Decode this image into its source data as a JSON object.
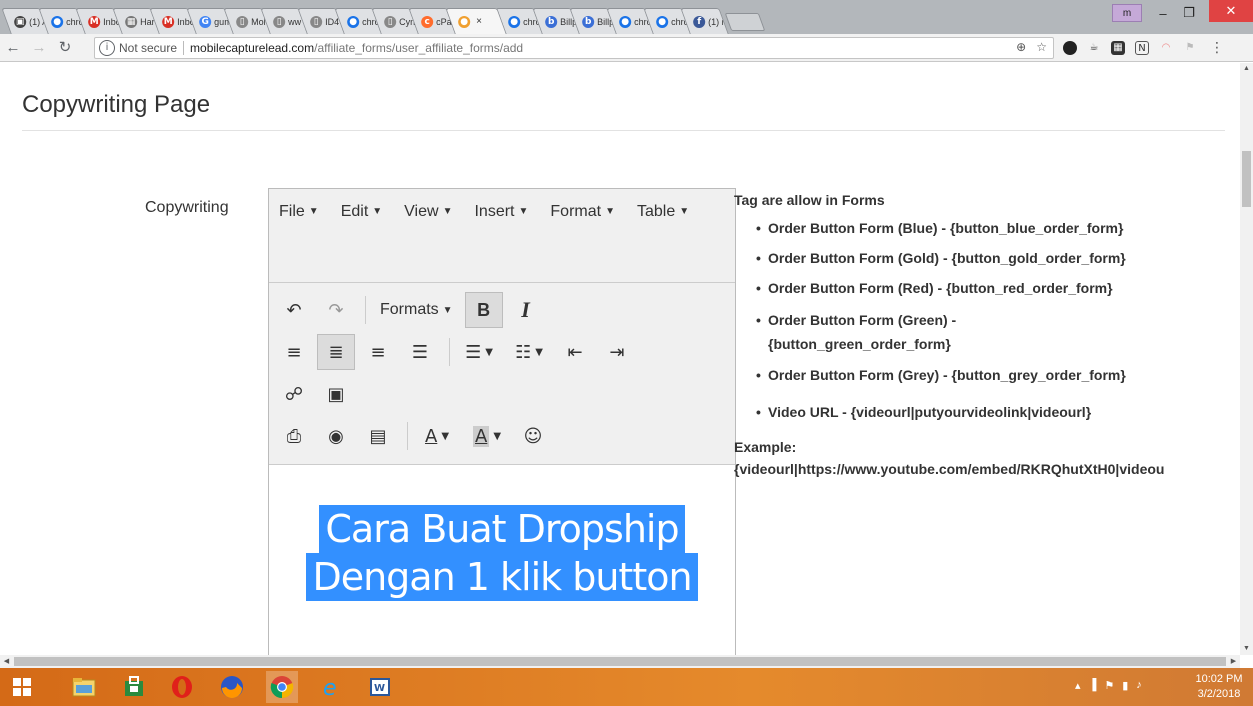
{
  "browser": {
    "tabs": [
      {
        "title": "(1) A",
        "icon": "app-icon",
        "color": "#444444",
        "glyph": "▣"
      },
      {
        "title": "chro",
        "icon": "chrome-icon",
        "color": "#1a73e8",
        "glyph": "●"
      },
      {
        "title": "Inbo",
        "icon": "gmail-icon",
        "color": "#d93025",
        "glyph": "M"
      },
      {
        "title": "Har",
        "icon": "image-icon",
        "color": "#777777",
        "glyph": "▦"
      },
      {
        "title": "Inbo",
        "icon": "gmail-icon",
        "color": "#d93025",
        "glyph": "M"
      },
      {
        "title": "gum",
        "icon": "google-icon",
        "color": "#4285f4",
        "glyph": "G"
      },
      {
        "title": "Mol",
        "icon": "page-icon",
        "color": "#888888",
        "glyph": "▯"
      },
      {
        "title": "ww",
        "icon": "page-icon",
        "color": "#888888",
        "glyph": "▯"
      },
      {
        "title": "ID4",
        "icon": "page-icon",
        "color": "#888888",
        "glyph": "▯"
      },
      {
        "title": "chro",
        "icon": "chrome-icon",
        "color": "#1a73e8",
        "glyph": "●"
      },
      {
        "title": "Cyn",
        "icon": "page-icon",
        "color": "#888888",
        "glyph": "▯"
      },
      {
        "title": "cPa",
        "icon": "cpanel-icon",
        "color": "#ff6c2c",
        "glyph": "c"
      },
      {
        "title": "",
        "icon": "active-site-icon",
        "color": "#f0a030",
        "glyph": "●",
        "active": true
      },
      {
        "title": "chro",
        "icon": "chrome-icon",
        "color": "#1a73e8",
        "glyph": "●"
      },
      {
        "title": "Billp",
        "icon": "billplz-icon",
        "color": "#3b6fd6",
        "glyph": "b"
      },
      {
        "title": "Billp",
        "icon": "billplz-icon",
        "color": "#3b6fd6",
        "glyph": "b"
      },
      {
        "title": "chro",
        "icon": "chrome-icon",
        "color": "#1a73e8",
        "glyph": "●"
      },
      {
        "title": "chro",
        "icon": "chrome-icon",
        "color": "#1a73e8",
        "glyph": "●"
      },
      {
        "title": "(1) r",
        "icon": "facebook-icon",
        "color": "#3b5998",
        "glyph": "f"
      }
    ],
    "address": {
      "security": "Not secure",
      "host": "mobilecapturelead.com",
      "path": "/affiliate_forms/user_affiliate_forms/add"
    }
  },
  "page": {
    "title": "Copywriting Page",
    "field_label": "Copywriting"
  },
  "editor": {
    "menus": [
      "File",
      "Edit",
      "View",
      "Insert",
      "Format",
      "Table"
    ],
    "formats_label": "Formats",
    "bold": "B",
    "italic": "I",
    "font_color_letter": "A",
    "bg_color_letter": "A",
    "content_lines": [
      "Cara Buat Dropship",
      "Dengan 1 klik button"
    ]
  },
  "tags": {
    "heading": "Tag are allow in Forms",
    "items": [
      "Order Button Form (Blue) - {button_blue_order_form}",
      "Order Button Form (Gold) - {button_gold_order_form}",
      "Order Button Form (Red) - {button_red_order_form}",
      "Order Button Form (Green) - {button_green_order_form}",
      "Order Button Form (Grey) - {button_grey_order_form}",
      "Video URL - {videourl|putyourvideolink|videourl}"
    ],
    "example_heading": "Example:",
    "example_text": "{videourl|https://www.youtube.com/embed/RKRQhutXtH0|videou"
  },
  "taskbar": {
    "time": "10:02 PM",
    "date": "3/2/2018"
  },
  "colors": {
    "selection": "#3390ff",
    "taskbar": "#e58a2c",
    "close_button": "#e04343"
  }
}
